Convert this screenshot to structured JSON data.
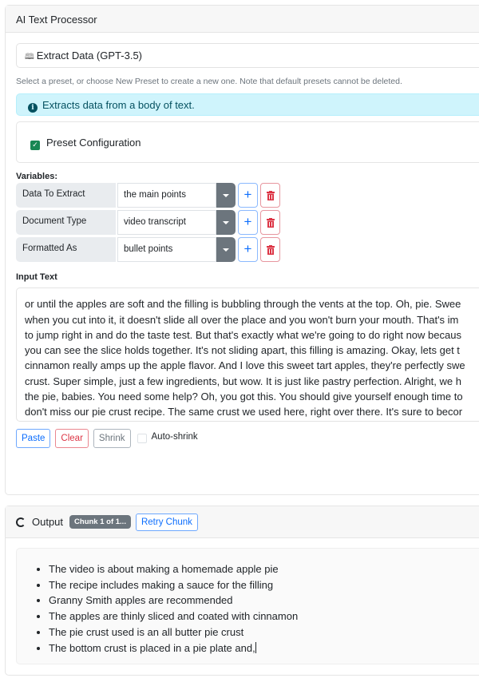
{
  "app": {
    "title": "AI Text Processor"
  },
  "preset": {
    "selected": "Extract Data (GPT-3.5)",
    "icon": "book-icon",
    "help": "Select a preset, or choose New Preset to create a new one. Note that default presets cannot be deleted.",
    "info": "Extracts data from a body of text.",
    "config_label": "Preset Configuration",
    "config_checked": true
  },
  "variables": {
    "label": "Variables:",
    "rows": [
      {
        "name": "Data To Extract",
        "value": "the main points"
      },
      {
        "name": "Document Type",
        "value": "video transcript"
      },
      {
        "name": "Formatted As",
        "value": "bullet points"
      }
    ]
  },
  "input": {
    "label": "Input Text",
    "lines": [
      "or until the apples are soft and the filling is bubbling through the vents at the top. Oh, pie. Swee",
      "when you cut into it, it doesn't slide all over the place and you won't burn your mouth. That's im",
      "to jump right in and do the taste test. But that's exactly what we're going to do right now becaus",
      "you can see the slice holds together. It's not sliding apart, this filling is amazing. Okay, lets get t",
      "cinnamon really amps up the apple flavor. And I love this sweet tart apples, they're perfectly swe",
      "crust. Super simple, just a few ingredients, but wow. It is just like pastry perfection. Alright, we h",
      "the pie, babies. You need some help? Oh, you got this. You should give yourself enough time to",
      "don't miss our pie crust recipe. The same crust we used here, right over there. It's sure to becor"
    ],
    "buttons": {
      "paste": "Paste",
      "clear": "Clear",
      "shrink": "Shrink"
    },
    "auto_shrink_label": "Auto-shrink",
    "auto_shrink_checked": false
  },
  "output": {
    "title": "Output",
    "chunk_badge": "Chunk 1 of 1...",
    "retry_label": "Retry Chunk",
    "items": [
      "The video is about making a homemade apple pie",
      "The recipe includes making a sauce for the filling",
      "Granny Smith apples are recommended",
      "The apples are thinly sliced and coated with cinnamon",
      "The pie crust used is an all butter pie crust",
      "The bottom crust is placed in a pie plate and,"
    ]
  },
  "colors": {
    "primary": "#0d6efd",
    "danger": "#dc3545",
    "success": "#198754",
    "info_bg": "#cff4fc",
    "secondary": "#6c757d"
  }
}
